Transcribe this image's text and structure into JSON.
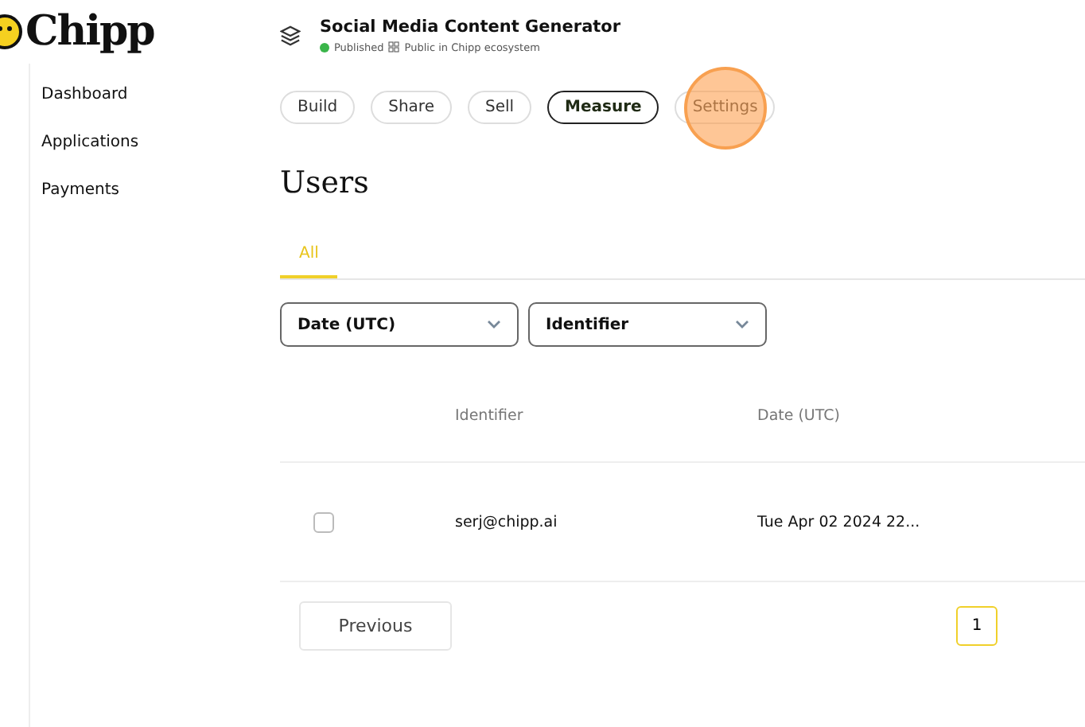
{
  "brand": {
    "name": "Chipp"
  },
  "sidebar": {
    "items": [
      {
        "label": "Dashboard"
      },
      {
        "label": "Applications"
      },
      {
        "label": "Payments"
      }
    ]
  },
  "app": {
    "title": "Social Media Content Generator",
    "status": "Published",
    "visibility": "Public in Chipp ecosystem"
  },
  "nav_tabs": [
    {
      "label": "Build",
      "selected": false,
      "clicked": false
    },
    {
      "label": "Share",
      "selected": false,
      "clicked": false
    },
    {
      "label": "Sell",
      "selected": false,
      "clicked": false
    },
    {
      "label": "Measure",
      "selected": true,
      "clicked": false
    },
    {
      "label": "Settings",
      "selected": false,
      "clicked": true
    }
  ],
  "heading": "Users",
  "subtabs": [
    {
      "label": "All",
      "selected": true
    }
  ],
  "filters": [
    {
      "label": "Date (UTC)"
    },
    {
      "label": "Identifier"
    }
  ],
  "table": {
    "columns": [
      "Identifier",
      "Date (UTC)"
    ],
    "rows": [
      {
        "checked": false,
        "identifier": "serj@chipp.ai",
        "date": "Tue Apr 02 2024 22..."
      }
    ]
  },
  "pagination": {
    "previous": "Previous",
    "pages": [
      {
        "label": "1",
        "selected": true
      }
    ]
  }
}
